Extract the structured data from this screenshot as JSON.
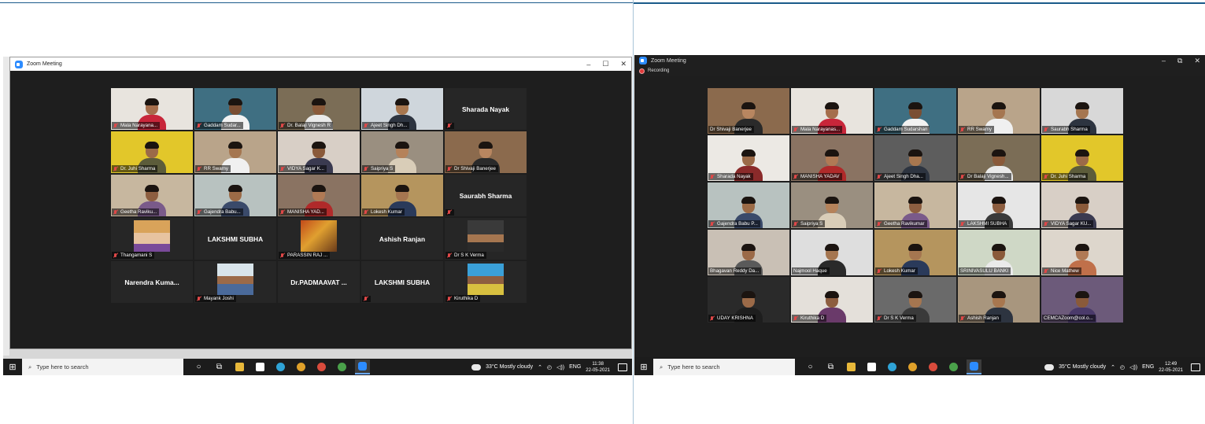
{
  "left": {
    "window_title": "Zoom Meeting",
    "controls": {
      "minimize": "–",
      "maximize": "☐",
      "close": "✕"
    },
    "participants": [
      {
        "name": "Mala Narayana...",
        "video": true,
        "muted": true,
        "bg": "#e8e4de",
        "skin": "#a56e4c",
        "shirt": "#c8263a"
      },
      {
        "name": "Gaddam Sudar...",
        "video": true,
        "muted": true,
        "bg": "#3f6f82",
        "skin": "#7a4e33",
        "shirt": "#f2f2f2"
      },
      {
        "name": "Dr. Balaji Vignesh R",
        "video": true,
        "muted": true,
        "active": true,
        "bg": "#7b6d56",
        "skin": "#8a5a3a",
        "shirt": "#eaeaea"
      },
      {
        "name": "Ajeet Singh Dh...",
        "video": true,
        "muted": true,
        "bg": "#cfd6dc",
        "skin": "#a8774f",
        "shirt": "#2d3440"
      },
      {
        "name": "Sharada Nayak",
        "video": false,
        "muted": true
      },
      {
        "name": "Dr. Juhi Sharma",
        "video": true,
        "muted": true,
        "bg": "#e2c72a",
        "skin": "#9b6a48",
        "shirt": "#5c5c3a"
      },
      {
        "name": "RR Swamy",
        "video": true,
        "muted": true,
        "bg": "#b9a48a",
        "skin": "#a57650",
        "shirt": "#f0f0f0"
      },
      {
        "name": "VIDYA Sagar K...",
        "video": true,
        "muted": true,
        "bg": "#d8cfc6",
        "skin": "#8a5a3a",
        "shirt": "#3a3a50"
      },
      {
        "name": "Saipriya S",
        "video": true,
        "muted": true,
        "bg": "#9a8f80",
        "skin": "#b5825a",
        "shirt": "#d9cdb8"
      },
      {
        "name": "Dr Shivaji Banerjee",
        "video": true,
        "muted": true,
        "bg": "#8b6a4d",
        "skin": "#b88660",
        "shirt": "#2a2a2a"
      },
      {
        "name": "Geetha Raviku...",
        "video": true,
        "muted": true,
        "bg": "#c7b79f",
        "skin": "#8d5e40",
        "shirt": "#7a5a8a"
      },
      {
        "name": "Gajendra Babu...",
        "video": true,
        "muted": true,
        "bg": "#b8c2c0",
        "skin": "#9c6b47",
        "shirt": "#3a4a6a"
      },
      {
        "name": "MANISHA YAD...",
        "video": true,
        "muted": true,
        "bg": "#8a7362",
        "skin": "#b07a55",
        "shirt": "#b02a2a"
      },
      {
        "name": "Lokesh Kumar",
        "video": true,
        "muted": true,
        "bg": "#b5955e",
        "skin": "#a57650",
        "shirt": "#2a3a5a"
      },
      {
        "name": "Saurabh Sharma",
        "video": false,
        "muted": true
      },
      {
        "name": "Thangamani S",
        "video": false,
        "avatar": "doll",
        "muted": true
      },
      {
        "name": "LAKSHMI SUBHA",
        "video": false,
        "muted": false
      },
      {
        "name": "PARASSIN RAJ ...",
        "video": false,
        "avatar": "painting",
        "muted": true
      },
      {
        "name": "Ashish Ranjan",
        "video": false,
        "muted": false
      },
      {
        "name": "Dr S K Verma",
        "video": false,
        "avatar": "photo",
        "muted": true
      },
      {
        "name": "Narendra Kuma...",
        "video": false,
        "muted": false
      },
      {
        "name": "Mayank Joshi",
        "video": false,
        "avatar": "photo-light",
        "muted": true
      },
      {
        "name": "Dr.PADMAAVAT ...",
        "video": false,
        "muted": false
      },
      {
        "name": "LAKSHMI SUBHA",
        "video": false,
        "muted": true
      },
      {
        "name": "Kiruthika D",
        "video": false,
        "avatar": "photo-blue",
        "muted": true
      }
    ],
    "taskbar": {
      "search_placeholder": "Type here to search",
      "weather": "33°C  Mostly cloudy",
      "lang": "ENG",
      "time": "11:38",
      "date": "22-05-2021"
    }
  },
  "right": {
    "window_title": "Zoom Meeting",
    "recording_label": "Recording",
    "controls": {
      "minimize": "–",
      "maximize": "⧉",
      "close": "✕"
    },
    "participants": [
      {
        "name": "Dr Shivaji Banerjee",
        "video": true,
        "muted": false,
        "bg": "#8b6a4d",
        "skin": "#b88660",
        "shirt": "#2a2a2a"
      },
      {
        "name": "Mala Narayanas...",
        "video": true,
        "muted": true,
        "bg": "#e8e4de",
        "skin": "#a56e4c",
        "shirt": "#c8263a"
      },
      {
        "name": "Gaddam Sudarshan",
        "video": true,
        "muted": true,
        "bg": "#3f6f82",
        "skin": "#7a4e33",
        "shirt": "#f2f2f2"
      },
      {
        "name": "RR Swamy",
        "video": true,
        "muted": true,
        "active": true,
        "bg": "#b9a48a",
        "skin": "#a57650",
        "shirt": "#f0f0f0"
      },
      {
        "name": "Saurabh Sharma",
        "video": true,
        "muted": true,
        "bg": "#d8d8d8",
        "skin": "#a57650",
        "shirt": "#2d3440"
      },
      {
        "name": "Sharada Nayak",
        "video": true,
        "muted": true,
        "bg": "#ece9e4",
        "skin": "#9b6a48",
        "shirt": "#8a2a2a"
      },
      {
        "name": "MANISHA YADAV",
        "video": true,
        "muted": true,
        "bg": "#8a7362",
        "skin": "#b07a55",
        "shirt": "#b02a2a"
      },
      {
        "name": "Ajeet Singh Dha...",
        "video": true,
        "muted": true,
        "bg": "#5d5d5d",
        "skin": "#a8774f",
        "shirt": "#2d3440"
      },
      {
        "name": "Dr Balaji Vignesh...",
        "video": true,
        "muted": true,
        "bg": "#7b6d56",
        "skin": "#8a5a3a",
        "shirt": "#eaeaea"
      },
      {
        "name": "Dr. Juhi Sharma",
        "video": true,
        "muted": true,
        "bg": "#e2c72a",
        "skin": "#9b6a48",
        "shirt": "#5c5c3a"
      },
      {
        "name": "Gajendra Babu P...",
        "video": true,
        "muted": true,
        "bg": "#b8c2c0",
        "skin": "#9c6b47",
        "shirt": "#3a4a6a"
      },
      {
        "name": "Saipriya S",
        "video": true,
        "muted": true,
        "bg": "#9a8f80",
        "skin": "#b5825a",
        "shirt": "#d9cdb8"
      },
      {
        "name": "Geetha Ravikumar",
        "video": true,
        "muted": true,
        "bg": "#c7b79f",
        "skin": "#8d5e40",
        "shirt": "#7a5a8a"
      },
      {
        "name": "LAKSHMI SUBHA",
        "video": true,
        "muted": true,
        "bg": "#e6e6e6",
        "skin": "#8d5e40",
        "shirt": "#3a3a3a"
      },
      {
        "name": "VIDYA Sagar KU...",
        "video": true,
        "muted": true,
        "bg": "#d8cfc6",
        "skin": "#8a5a3a",
        "shirt": "#3a3a50"
      },
      {
        "name": "Bhagavan Reddy Da...",
        "video": true,
        "muted": false,
        "bg": "#c9c0b5",
        "skin": "#9b6a48",
        "shirt": "#5a5a5a"
      },
      {
        "name": "Najmool Haque",
        "video": true,
        "muted": false,
        "bg": "#dedede",
        "skin": "#a57650",
        "shirt": "#2a2a2a"
      },
      {
        "name": "Lokesh Kumar",
        "video": true,
        "muted": true,
        "bg": "#b5955e",
        "skin": "#a57650",
        "shirt": "#2a3a5a"
      },
      {
        "name": "SRINIVASULU BANKI",
        "video": true,
        "muted": false,
        "bg": "#cfd8c6",
        "skin": "#8a5a3a",
        "shirt": "#eaeaea"
      },
      {
        "name": "Nice Mathew",
        "video": true,
        "muted": true,
        "bg": "#ddd6cc",
        "skin": "#b07a55",
        "shirt": "#c0704a"
      },
      {
        "name": "UDAY KRISHNA",
        "video": true,
        "muted": true,
        "bg": "#2a2a2a",
        "skin": "#9b6a48",
        "shirt": "#1e1e1e"
      },
      {
        "name": "Kiruthika D",
        "video": true,
        "muted": true,
        "bg": "#e4e0da",
        "skin": "#8d5e40",
        "shirt": "#6a3a6a"
      },
      {
        "name": "Dr S K Verma",
        "video": true,
        "muted": true,
        "bg": "#6a6a6a",
        "skin": "#a57650",
        "shirt": "#3a3a3a"
      },
      {
        "name": "Ashish Ranjan",
        "video": true,
        "muted": true,
        "bg": "#a8967e",
        "skin": "#a8774f",
        "shirt": "#2d3440"
      },
      {
        "name": "CEMCAZoom@col.o...",
        "video": true,
        "muted": false,
        "bg": "#6c5a7a",
        "skin": "#8a5a3a",
        "shirt": "#4a3a6a"
      }
    ],
    "taskbar": {
      "search_placeholder": "Type here to search",
      "weather": "35°C  Mostly cloudy",
      "lang": "ENG",
      "time": "12:49",
      "date": "22-05-2021"
    }
  }
}
